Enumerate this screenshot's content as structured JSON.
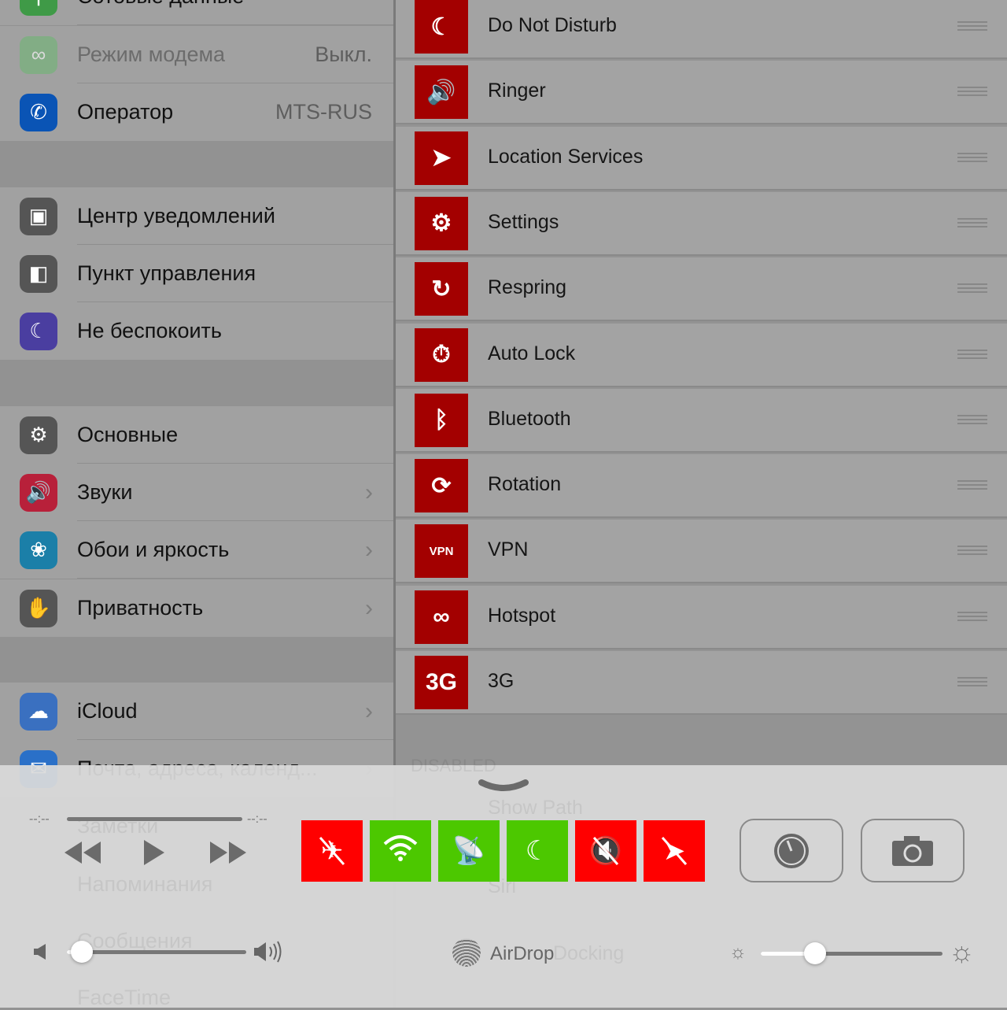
{
  "settings": {
    "rows": [
      {
        "label": "Сотовые данные",
        "value": "",
        "icon": "cellular-icon",
        "color": "#3f9a47"
      },
      {
        "label": "Режим модема",
        "value": "Выкл.",
        "icon": "hotspot-icon",
        "color": "#6eb574",
        "dim": true
      },
      {
        "label": "Оператор",
        "value": "MTS-RUS",
        "icon": "phone-icon",
        "color": "#0a54b5"
      },
      {
        "label": "Центр уведомлений",
        "icon": "notification-center-icon",
        "color": "#555"
      },
      {
        "label": "Пункт управления",
        "icon": "control-center-icon",
        "color": "#555"
      },
      {
        "label": "Не беспокоить",
        "icon": "moon-icon",
        "color": "#4a3ea0"
      },
      {
        "label": "Основные",
        "icon": "gear-icon",
        "color": "#555"
      },
      {
        "label": "Звуки",
        "icon": "speaker-icon",
        "color": "#b8203a"
      },
      {
        "label": "Обои и яркость",
        "icon": "wallpaper-icon",
        "color": "#1b7fa8"
      },
      {
        "label": "Приватность",
        "icon": "hand-icon",
        "color": "#555"
      },
      {
        "label": "iCloud",
        "icon": "cloud-icon",
        "color": "#3a70c0"
      },
      {
        "label": "Почта, адреса, календ...",
        "icon": "mail-icon",
        "color": "#2a70c8"
      }
    ],
    "ghost": [
      "Заметки",
      "Напоминания",
      "Сообщения",
      "FaceTime"
    ]
  },
  "toggles_list": {
    "enabled": [
      {
        "label": "Do Not Disturb",
        "icon": "moon-icon",
        "glyph": "☾"
      },
      {
        "label": "Ringer",
        "icon": "speaker-icon",
        "glyph": "🔊"
      },
      {
        "label": "Location Services",
        "icon": "location-arrow-icon",
        "glyph": "➤"
      },
      {
        "label": "Settings",
        "icon": "gear-icon",
        "glyph": "⚙"
      },
      {
        "label": "Respring",
        "icon": "respring-icon",
        "glyph": "↻"
      },
      {
        "label": "Auto Lock",
        "icon": "lock-timer-icon",
        "glyph": "⏱"
      },
      {
        "label": "Bluetooth",
        "icon": "bluetooth-icon",
        "glyph": "ᛒ"
      },
      {
        "label": "Rotation",
        "icon": "rotation-icon",
        "glyph": "⟳"
      },
      {
        "label": "VPN",
        "icon": "vpn-icon",
        "glyph": "VPN"
      },
      {
        "label": "Hotspot",
        "icon": "hotspot-icon",
        "glyph": "∞"
      },
      {
        "label": "3G",
        "icon": "3g-icon",
        "glyph": "3G"
      }
    ],
    "disabled_header": "DISABLED",
    "ghost": [
      "Show Path",
      "Siri",
      "Docking"
    ]
  },
  "control_center": {
    "elapsed": "--:--",
    "remaining": "--:--",
    "track_progress": 0,
    "volume": 0.08,
    "brightness": 0.3,
    "airdrop_label": "AirDrop",
    "toggles": [
      {
        "name": "airplane-mode",
        "state": "off",
        "color": "#ff0000",
        "glyph": "✈"
      },
      {
        "name": "wifi",
        "state": "on",
        "color": "#4cc800",
        "glyph": "wifi"
      },
      {
        "name": "cellular-data",
        "state": "on",
        "color": "#4cc800",
        "glyph": "📡"
      },
      {
        "name": "do-not-disturb",
        "state": "on",
        "color": "#4cc800",
        "glyph": "☾"
      },
      {
        "name": "ringer",
        "state": "off",
        "color": "#ff0000",
        "glyph": "🔇"
      },
      {
        "name": "location",
        "state": "off",
        "color": "#ff0000",
        "glyph": "➤"
      }
    ]
  }
}
